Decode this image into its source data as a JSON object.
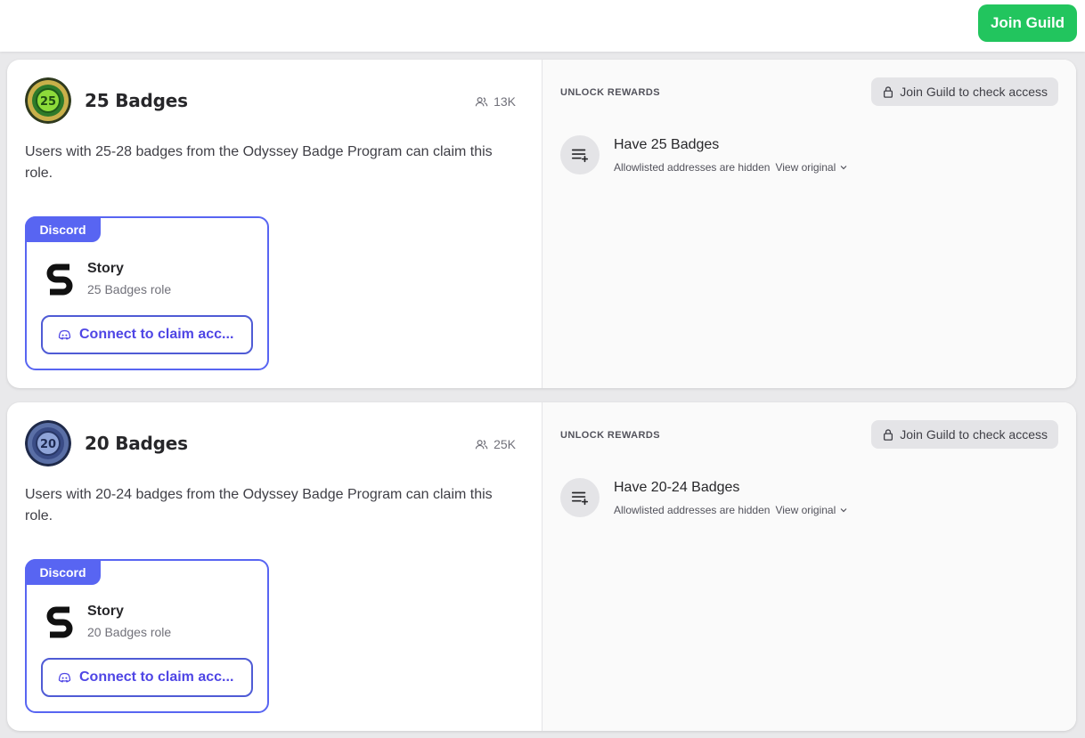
{
  "header": {
    "join_label": "Join Guild",
    "accent": "#22c55e"
  },
  "roles": [
    {
      "name": "25 Badges",
      "badge_number": "25",
      "member_count": "13K",
      "description": "Users with 25-28 badges from the Odyssey Badge Program can claim this role.",
      "reward": {
        "platform": "Discord",
        "server": "Story",
        "role": "25 Badges role",
        "connect_label": "Connect to claim acc..."
      },
      "requirements": {
        "section_label": "UNLOCK REWARDS",
        "check_label": "Join Guild to check access",
        "title": "Have 25 Badges",
        "note": "Allowlisted addresses are hidden",
        "view_label": "View original"
      }
    },
    {
      "name": "20 Badges",
      "badge_number": "20",
      "member_count": "25K",
      "description": "Users with 20-24 badges from the Odyssey Badge Program can claim this role.",
      "reward": {
        "platform": "Discord",
        "server": "Story",
        "role": "20 Badges role",
        "connect_label": "Connect to claim acc..."
      },
      "requirements": {
        "section_label": "UNLOCK REWARDS",
        "check_label": "Join Guild to check access",
        "title": "Have 20-24 Badges",
        "note": "Allowlisted addresses are hidden",
        "view_label": "View original"
      }
    }
  ],
  "colors": {
    "discord": "#5865f2",
    "discord_text": "#4f46e5"
  }
}
